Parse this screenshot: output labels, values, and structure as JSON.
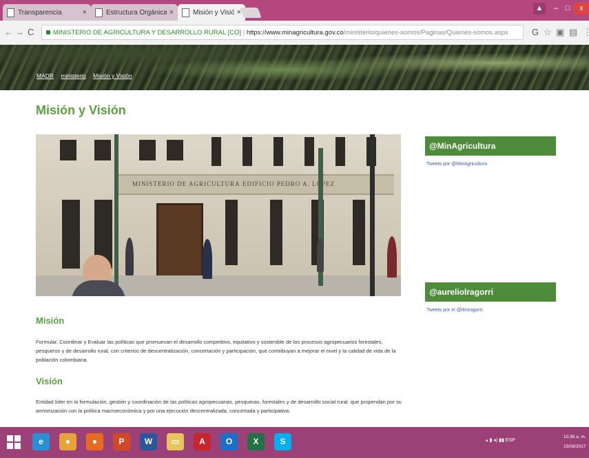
{
  "browser": {
    "tabs": [
      {
        "title": "Transparencia",
        "active": false
      },
      {
        "title": "Estructura Orgánica y Ta",
        "active": false
      },
      {
        "title": "Misión y Visión",
        "active": true
      }
    ],
    "address": {
      "site_name": "MINISTERIO DE AGRICULTURA Y DESARROLLO RURAL [CO]",
      "separator": "|",
      "url_host": "https://www.minagricultura.gov.co",
      "url_path": "/ministerio/quienes-somos/Paginas/Quienes-somos.aspx"
    },
    "window_controls": {
      "minimize": "–",
      "maximize": "□",
      "close": "x"
    },
    "colors": {
      "tabstrip": "#b4487e",
      "close": "#e04343"
    }
  },
  "breadcrumb": [
    "MADR",
    "ministerio",
    "Misión y Visión"
  ],
  "page": {
    "title": "Misión y Visión",
    "hero": {
      "inscription_left": "MINISTERIO DE AGRICULTURA",
      "inscription_right": "EDIFICIO PEDRO A. LOPEZ"
    },
    "mision": {
      "heading": "Misión",
      "text": "Formular, Coordinar y Evaluar las políticas que promuevan el desarrollo competitivo, equitativo y sostenible de los procesos agropecuarios forestales, pesqueros y de desarrollo rural, con criterios de descentralización, concertación y participación, que contribuyan a mejorar el nivel y la calidad de vida de la población colombiana."
    },
    "vision": {
      "heading": "Visión",
      "text": "Entidad líder en la formulación, gestión y coordinación de las políticas agropecuarias, pesqueras, forestales y de desarrollo social rural, que propendan por su armonización con la política macroeconómica y por una ejecución descentralizada, concertada y participativa."
    },
    "accent_color": "#5aa03c"
  },
  "sidebar": {
    "widgets": [
      {
        "handle": "@MinAgricultura",
        "link": "Tweets por @MinAgricultura"
      },
      {
        "handle": "@aureliolragorri",
        "link": "Tweets por el @Iliniragorri."
      }
    ],
    "widget_color": "#4e8c3c"
  },
  "taskbar": {
    "apps": [
      {
        "name": "ie-icon",
        "glyph": "e",
        "color": "#2b8fd8"
      },
      {
        "name": "chrome-icon",
        "glyph": "●",
        "color": "#e9a23b"
      },
      {
        "name": "firefox-icon",
        "glyph": "●",
        "color": "#e66a1f"
      },
      {
        "name": "powerpoint-icon",
        "glyph": "P",
        "color": "#d24726"
      },
      {
        "name": "word-icon",
        "glyph": "W",
        "color": "#2b579a"
      },
      {
        "name": "file-explorer-icon",
        "glyph": "▭",
        "color": "#e8c55b"
      },
      {
        "name": "acrobat-icon",
        "glyph": "A",
        "color": "#c8262a"
      },
      {
        "name": "outlook-icon",
        "glyph": "O",
        "color": "#1c6ec7"
      },
      {
        "name": "excel-icon",
        "glyph": "X",
        "color": "#217346"
      },
      {
        "name": "skype-icon",
        "glyph": "S",
        "color": "#00aff0"
      }
    ],
    "tray": {
      "language": "ESP"
    },
    "clock": {
      "time": "10:36 a. m.",
      "date": "15/08/2017"
    }
  }
}
